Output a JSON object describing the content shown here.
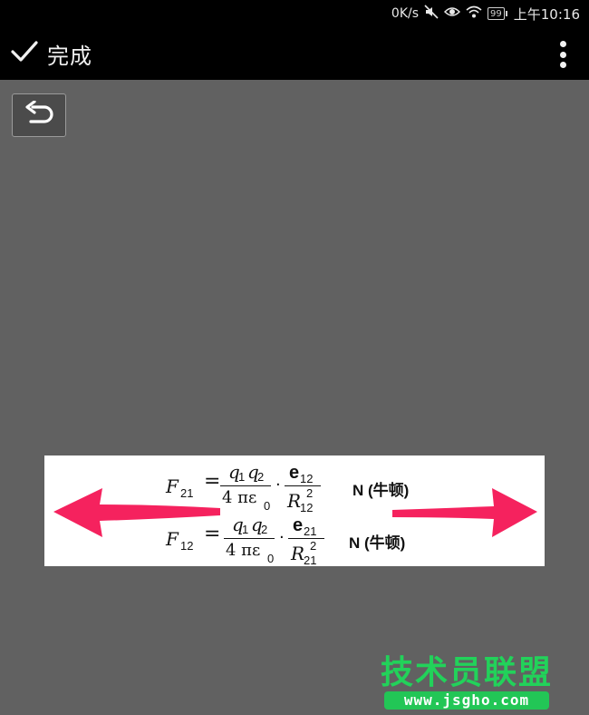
{
  "status_bar": {
    "net_speed": "0K/s",
    "battery": "99",
    "time": "上午10:16",
    "icons": [
      "mute-icon",
      "eye-icon",
      "wifi-icon",
      "battery-icon"
    ]
  },
  "toolbar": {
    "done_label": "完成",
    "done_icon": "check-icon",
    "more_icon": "more-vert-icon"
  },
  "editor": {
    "undo_icon": "undo-icon"
  },
  "image_content": {
    "formula1": {
      "lhs": "F",
      "lhs_sub": "21",
      "num_a": "q",
      "num_a_sub": "1",
      "num_b": "q",
      "num_b_sub": "2",
      "den": "4 πε",
      "den_sub": "0",
      "vec": "e",
      "vec_sub": "12",
      "r": "R",
      "r_sub": "12",
      "r_sup": "2",
      "unit": "N (牛顿)"
    },
    "formula2": {
      "lhs": "F",
      "lhs_sub": "12",
      "num_a": "q",
      "num_a_sub": "1",
      "num_b": "q",
      "num_b_sub": "2",
      "den": "4 πε",
      "den_sub": "0",
      "vec": "e",
      "vec_sub": "21",
      "r": "R",
      "r_sub": "21",
      "r_sup": "2",
      "unit": "N (牛顿)"
    },
    "arrow_color": "#f5225e"
  },
  "watermark": {
    "logo_text": "技术员联盟",
    "url": "www.jsgho.com",
    "color": "#22c656"
  }
}
